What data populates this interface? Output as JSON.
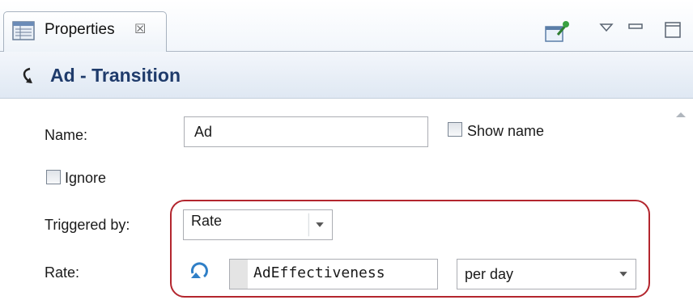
{
  "tab": {
    "label": "Properties",
    "close_glyph": "☒"
  },
  "header": {
    "title": "Ad - Transition"
  },
  "form": {
    "name_label": "Name:",
    "name_value": "Ad",
    "show_name_label": "Show name",
    "ignore_label": "Ignore",
    "triggered_by_label": "Triggered by:",
    "triggered_by_value": "Rate",
    "rate_label": "Rate:",
    "rate_value": "AdEffectiveness",
    "rate_unit": "per day"
  },
  "colors": {
    "title": "#1f3b6b",
    "highlight": "#b3262e"
  },
  "icons": [
    "properties-view-icon",
    "pin-icon",
    "view-menu-icon",
    "minimize-icon",
    "maximize-icon",
    "transition-icon",
    "code-toggle-icon",
    "scroll-up-arrow-icon",
    "combo-arrow-icon"
  ]
}
